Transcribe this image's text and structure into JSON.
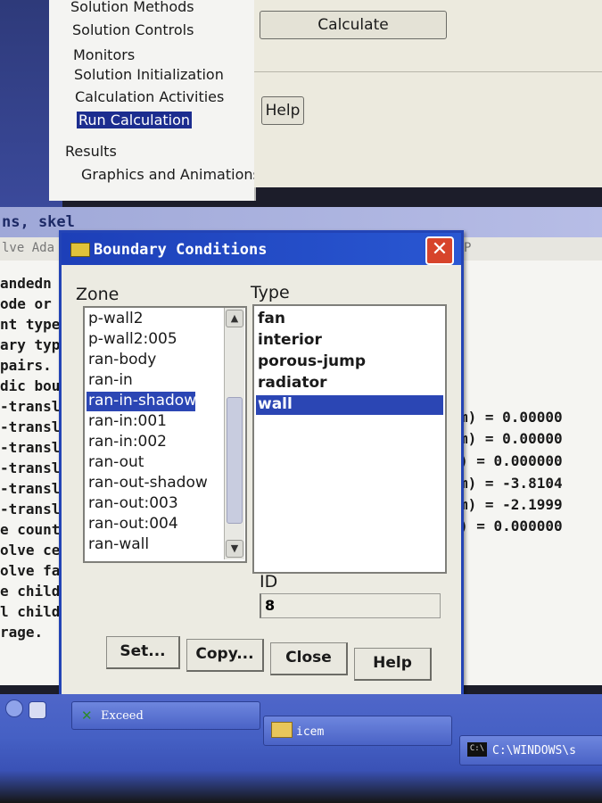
{
  "tree": {
    "items": [
      "Solution Methods",
      "Solution Controls",
      "Monitors",
      "Solution Initialization",
      "Calculation Activities",
      "Run Calculation"
    ],
    "results_label": "Results",
    "graphics_label": "Graphics and Animations"
  },
  "task_panel": {
    "calculate_label": "Calculate",
    "help_label": "Help"
  },
  "console": {
    "title": "ns, skel",
    "bar_left": "lve Ada",
    "bar_right": "P",
    "left_lines": [
      "andedn",
      "ode or",
      "nt type",
      "ary typ",
      "pairs.",
      "dic bou",
      "-transla",
      "-transla",
      "-transla",
      "-transla",
      "-transla",
      "-transla",
      "e count.",
      "olve cell",
      "olve face",
      "e childre",
      "l childre",
      "rage."
    ],
    "right_lines": [
      "m)  =  0.00000",
      "m)  =  0.00000",
      ")  =  0.000000",
      "m)  =  -3.8104",
      "m)  =  -2.1999",
      ")  =  0.000000"
    ]
  },
  "dialog": {
    "title": "Boundary Conditions",
    "zone_label": "Zone",
    "type_label": "Type",
    "zones": [
      "p-wall2",
      "p-wall2:005",
      "ran-body",
      "ran-in",
      "ran-in-shadow",
      "ran-in:001",
      "ran-in:002",
      "ran-out",
      "ran-out-shadow",
      "ran-out:003",
      "ran-out:004",
      "ran-wall"
    ],
    "selected_zone": "ran-in-shadow",
    "types": [
      "fan",
      "interior",
      "porous-jump",
      "radiator",
      "wall"
    ],
    "selected_type": "wall",
    "id_label": "ID",
    "id_value": "8",
    "buttons": {
      "set": "Set...",
      "copy": "Copy...",
      "close": "Close",
      "help": "Help"
    },
    "close_glyph": "✕"
  },
  "taskbar": {
    "exceed_label": "Exceed",
    "icem_label": "icem",
    "cmd_label": "C:\\WINDOWS\\s",
    "cmd_icon_text": "C:\\"
  },
  "colors": {
    "selection": "#2b46b4",
    "title_bar": "#1d3fb8",
    "close_button": "#d7442b"
  }
}
